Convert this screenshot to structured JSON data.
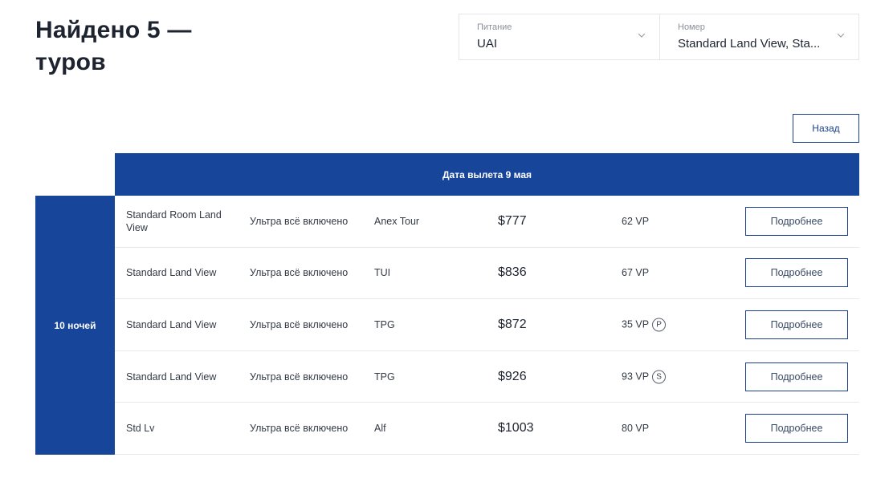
{
  "header": {
    "title": "Найдено 5 — туров"
  },
  "filters": {
    "meal": {
      "label": "Питание",
      "value": "UAI",
      "icon": "chevron-down-icon"
    },
    "room": {
      "label": "Номер",
      "value": "Standard Land View, Sta...",
      "icon": "chevron-down-icon"
    }
  },
  "back_button_label": "Назад",
  "table": {
    "date_header": "Дата вылета 9 мая",
    "nights_label": "10 ночей",
    "rows": [
      {
        "room": "Standard Room Land View",
        "meal": "Ультра всё включено",
        "operator": "Anex Tour",
        "price": "$777",
        "vp": "62 VP",
        "badge": "",
        "details_label": "Подробнее"
      },
      {
        "room": "Standard Land View",
        "meal": "Ультра всё включено",
        "operator": "TUI",
        "price": "$836",
        "vp": "67 VP",
        "badge": "",
        "details_label": "Подробнее"
      },
      {
        "room": "Standard Land View",
        "meal": "Ультра всё включено",
        "operator": "TPG",
        "price": "$872",
        "vp": "35 VP",
        "badge": "P",
        "details_label": "Подробнее"
      },
      {
        "room": "Standard Land View",
        "meal": "Ультра всё включено",
        "operator": "TPG",
        "price": "$926",
        "vp": "93 VP",
        "badge": "S",
        "details_label": "Подробнее"
      },
      {
        "room": "Std Lv",
        "meal": "Ультра всё включено",
        "operator": "Alf",
        "price": "$1003",
        "vp": "80 VP",
        "badge": "",
        "details_label": "Подробнее"
      }
    ]
  },
  "colors": {
    "accent_blue": "#17459a",
    "button_border": "#1a3f8f"
  }
}
